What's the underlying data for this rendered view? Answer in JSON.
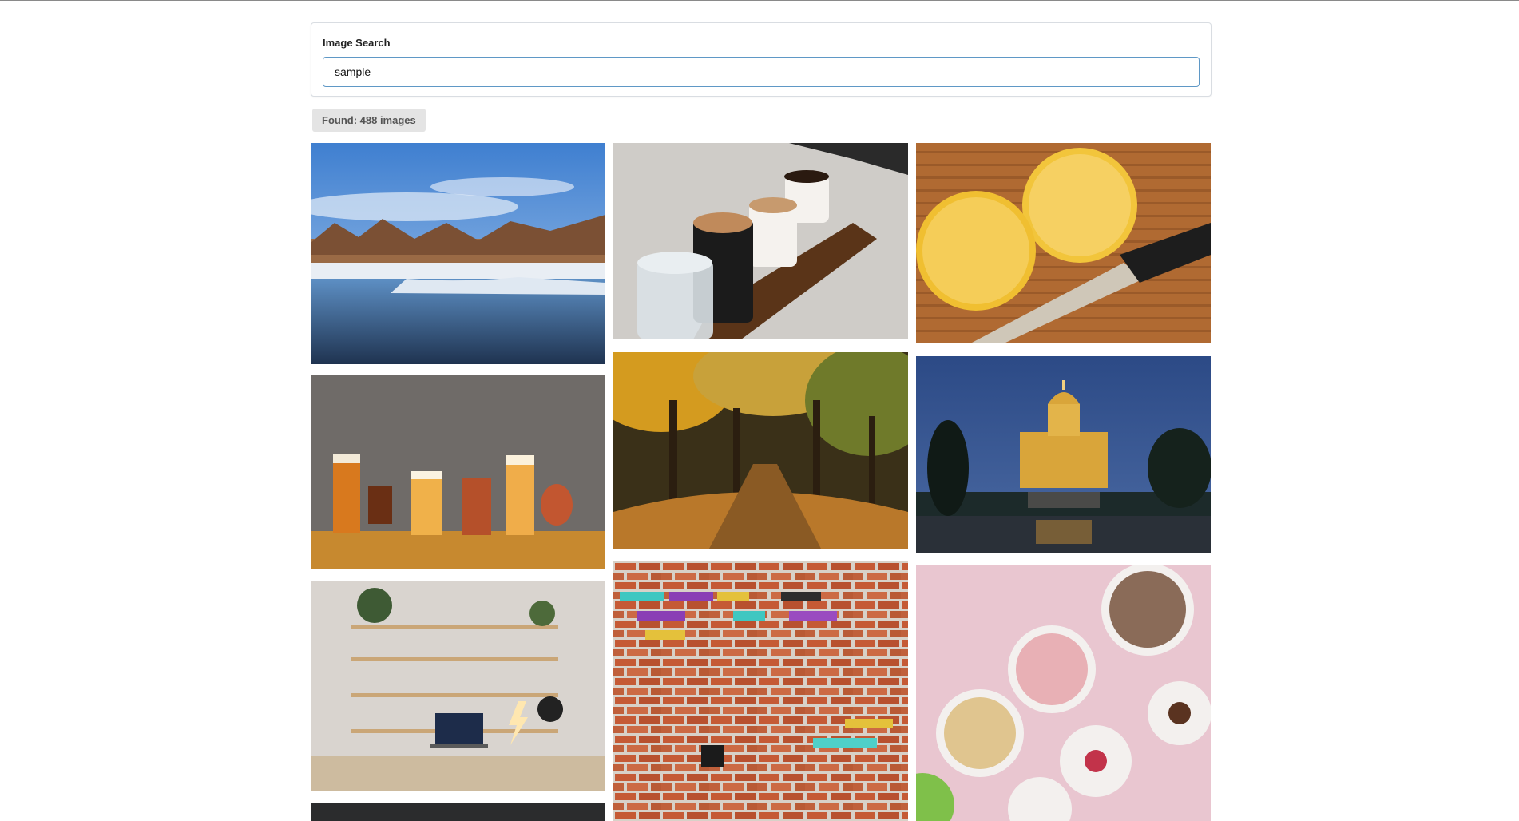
{
  "search": {
    "label": "Image Search",
    "value": "sample"
  },
  "results": {
    "summary": "Found: 488 images"
  },
  "gallery": {
    "images": [
      {
        "subject": "winter river landscape"
      },
      {
        "subject": "coffee cups"
      },
      {
        "subject": "sliced lemon with knife"
      },
      {
        "subject": "beer glasses"
      },
      {
        "subject": "autumn forest path"
      },
      {
        "subject": "cathedral at night"
      },
      {
        "subject": "desk setup with shelves"
      },
      {
        "subject": "painted brick wall"
      },
      {
        "subject": "dessert cups"
      },
      {
        "subject": "dark image"
      }
    ]
  },
  "colors": {
    "input_border": "#5f98c6",
    "badge_background": "#e4e4e4"
  }
}
